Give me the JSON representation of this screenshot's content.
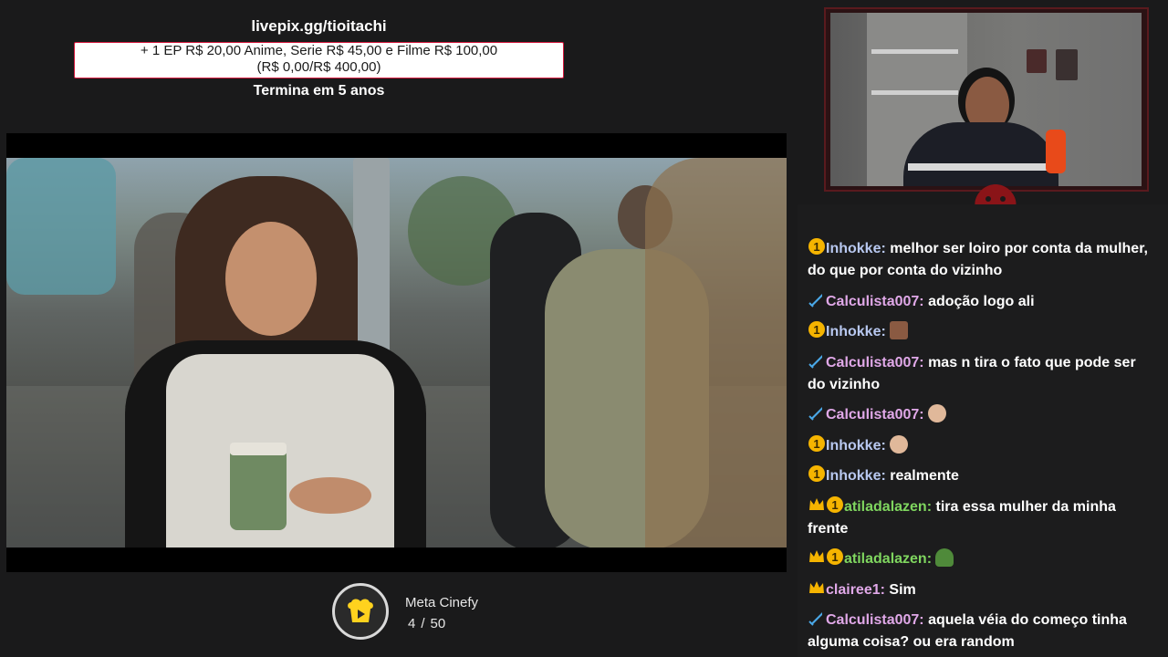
{
  "goal": {
    "link": "livepix.gg/tioitachi",
    "line1": "+ 1 EP R$ 20,00 Anime, Serie R$ 45,00 e Filme R$ 100,00",
    "line2": "(R$ 0,00/R$ 400,00)",
    "footer": "Termina em 5 anos",
    "progress": 0.0
  },
  "meta": {
    "title": "Meta Cinefy",
    "current": "4",
    "separator": "/",
    "total": "50",
    "icon": "cinefy-logo-icon"
  },
  "colors": {
    "accent_red": "#d4183d",
    "chat_bg": "#1c1c1d",
    "page_bg": "#1a1a1b"
  },
  "chat": {
    "messages": [
      {
        "badges": [
          "sub-1-badge"
        ],
        "user": "Inhokke",
        "text": "melhor ser loiro por conta da mulher, do que por conta do vizinho"
      },
      {
        "badges": [
          "sword-badge"
        ],
        "user": "Calculista007",
        "text": "adoção logo ali"
      },
      {
        "badges": [
          "sub-1-badge"
        ],
        "user": "Inhokke",
        "text": "",
        "emote": "face-emote"
      },
      {
        "badges": [
          "sword-badge"
        ],
        "user": "Calculista007",
        "text": "mas n tira o fato que pode ser do vizinho"
      },
      {
        "badges": [
          "sword-badge"
        ],
        "user": "Calculista007",
        "text": "",
        "emote": "hand-emote"
      },
      {
        "badges": [
          "sub-1-badge"
        ],
        "user": "Inhokke",
        "text": "",
        "emote": "hand-emote"
      },
      {
        "badges": [
          "sub-1-badge"
        ],
        "user": "Inhokke",
        "text": "realmente"
      },
      {
        "badges": [
          "crown-badge",
          "sub-1-badge"
        ],
        "user": "atiladalazen",
        "text": "tira essa mulher da minha frente"
      },
      {
        "badges": [
          "crown-badge",
          "sub-1-badge"
        ],
        "user": "atiladalazen",
        "text": "",
        "emote": "frog-emote"
      },
      {
        "badges": [
          "crown-badge"
        ],
        "user": "clairee1",
        "text": "Sim"
      },
      {
        "badges": [
          "sword-badge"
        ],
        "user": "Calculista007",
        "text": "aquela véia do começo tinha alguma coisa? ou era random"
      }
    ]
  }
}
